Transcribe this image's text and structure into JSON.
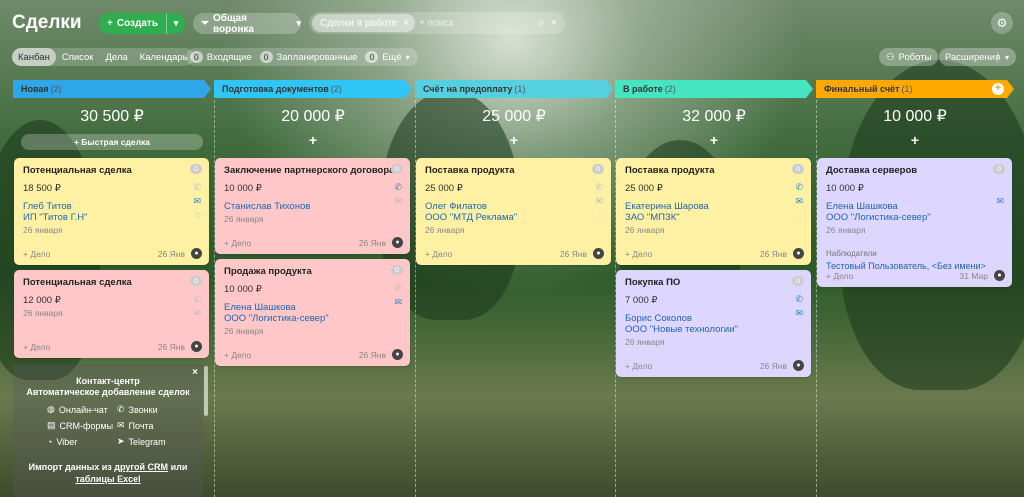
{
  "header": {
    "title": "Сделки",
    "create_label": "Создать",
    "funnel_label": "Общая воронка",
    "filter_chip": "Сделки в работе",
    "search_placeholder": "+ поиск"
  },
  "views": [
    "Канбан",
    "Список",
    "Дела",
    "Календарь"
  ],
  "counters": [
    {
      "count": "0",
      "label": "Входящие"
    },
    {
      "count": "0",
      "label": "Запланированные"
    },
    {
      "count": "0",
      "label": "Ещё"
    }
  ],
  "right_buttons": {
    "robots": "Роботы",
    "extensions": "Расширения"
  },
  "quick_deal": "Быстрая сделка",
  "add_activity": "+ Дело",
  "observers_label": "Наблюдатели",
  "columns": [
    {
      "name": "Новая",
      "count": "(2)",
      "sum": "30 500 ₽",
      "color": "#2fa6e8"
    },
    {
      "name": "Подготовка документов",
      "count": "(2)",
      "sum": "20 000 ₽",
      "color": "#2fc6f6"
    },
    {
      "name": "Счёт на предоплату",
      "count": "(1)",
      "sum": "25 000 ₽",
      "color": "#55d0e0"
    },
    {
      "name": "В работе",
      "count": "(2)",
      "sum": "32 000 ₽",
      "color": "#47e4c2"
    },
    {
      "name": "Финальный счёт",
      "count": "(1)",
      "sum": "10 000 ₽",
      "color": "#ffa900"
    }
  ],
  "cards": [
    {
      "title": "Потенциальная сделка",
      "value": "18 500 ₽",
      "contact": "Глеб Титов",
      "company": "ИП \"Титов Г.Н\"",
      "created": "26 января",
      "date": "26 Янв",
      "badge": "0",
      "color": "#fff1a3"
    },
    {
      "title": "Потенциальная сделка",
      "value": "12 000 ₽",
      "contact": "",
      "company": "",
      "created": "26 января",
      "date": "26 Янв",
      "badge": "0",
      "color": "#ffc7c7"
    },
    {
      "title": "Заключение партнерского договора",
      "value": "10 000 ₽",
      "contact": "Станислав Тихонов",
      "company": "",
      "created": "26 января",
      "date": "26 Янв",
      "badge": "0",
      "color": "#ffc7c7"
    },
    {
      "title": "Продажа продукта",
      "value": "10 000 ₽",
      "contact": "Елена Шашкова",
      "company": "ООО \"Логистика-север\"",
      "created": "26 января",
      "date": "26 Янв",
      "badge": "0",
      "color": "#ffc7c7"
    },
    {
      "title": "Поставка продукта",
      "value": "25 000 ₽",
      "contact": "Олег Филатов",
      "company": "ООО \"МТД Реклама\"",
      "created": "26 января",
      "date": "26 Янв",
      "badge": "0",
      "color": "#fff1a3"
    },
    {
      "title": "Поставка продукта",
      "value": "25 000 ₽",
      "contact": "Екатерина Шарова",
      "company": "ЗАО \"МПЗК\"",
      "created": "26 января",
      "date": "26 Янв",
      "badge": "0",
      "color": "#fff1a3"
    },
    {
      "title": "Покупка ПО",
      "value": "7 000 ₽",
      "contact": "Борис Соколов",
      "company": "ООО \"Новые технологии\"",
      "created": "26 января",
      "date": "26 Янв",
      "badge": "0",
      "color": "#ddd6ff"
    },
    {
      "title": "Доставка серверов",
      "value": "10 000 ₽",
      "contact": "Елена Шашкова",
      "company": "ООО \"Логистика-север\"",
      "created": "26 января",
      "date": "31 Мар",
      "badge": "0",
      "color": "#ddd6ff",
      "observer": "Тестовый Пользователь, <Без имени>"
    }
  ],
  "contact_center": {
    "title": "Контакт-центр",
    "subtitle": "Автоматическое добавление сделок",
    "items": [
      "Онлайн-чат",
      "Звонки",
      "CRM-формы",
      "Почта",
      "Viber",
      "Telegram"
    ],
    "import_text": "Импорт данных из",
    "import_link1": "другой CRM",
    "import_or": "или",
    "import_link2": "таблицы Excel"
  },
  "colors": {
    "accent_green": "#2fae4f",
    "link_blue": "#2066b0"
  }
}
